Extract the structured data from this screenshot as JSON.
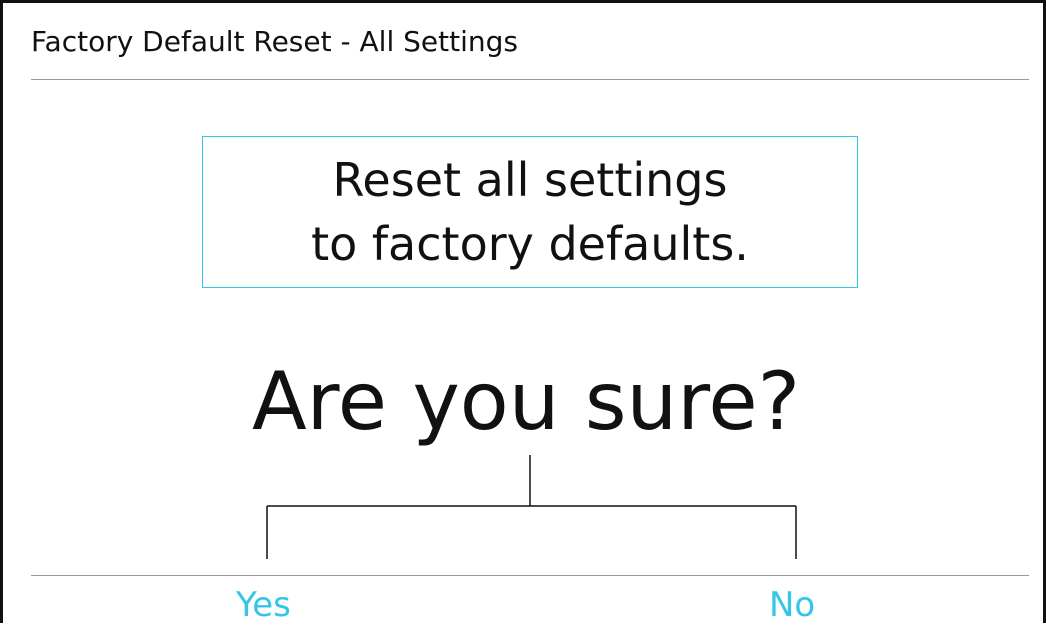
{
  "dialog": {
    "title": "Factory Default Reset - All Settings",
    "message_line1": "Reset all settings",
    "message_line2": "to factory defaults.",
    "question": "Are you sure?",
    "options": {
      "yes_label": "Yes",
      "no_label": "No"
    }
  },
  "colors": {
    "accent": "#34c6e6",
    "text": "#111111",
    "divider": "#9a9a9a"
  }
}
